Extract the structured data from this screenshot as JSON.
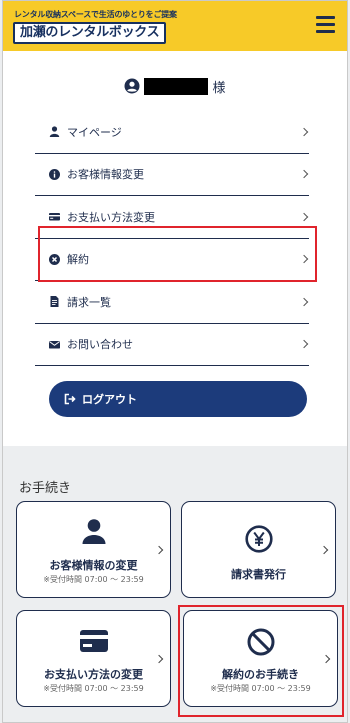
{
  "header": {
    "tagline": "レンタル収納スペースで生活のゆとりをご提案",
    "brand": "加瀬のレンタルボックス"
  },
  "user": {
    "suffix": "様"
  },
  "menu": {
    "items": [
      {
        "label": "マイページ",
        "icon": "user-icon"
      },
      {
        "label": "お客様情報変更",
        "icon": "info-icon"
      },
      {
        "label": "お支払い方法変更",
        "icon": "credit-card-icon"
      },
      {
        "label": "解約",
        "icon": "cancel-circle-icon"
      },
      {
        "label": "請求一覧",
        "icon": "document-icon"
      },
      {
        "label": "お問い合わせ",
        "icon": "envelope-icon"
      }
    ],
    "logout_label": "ログアウト"
  },
  "procedures": {
    "title": "お手続き",
    "cards": [
      {
        "title": "お客様情報の変更",
        "sub": "※受付時間 07:00 ～ 23:59",
        "icon": "person-icon"
      },
      {
        "title": "請求書発行",
        "sub": "",
        "icon": "yen-circle-icon"
      },
      {
        "title": "お支払い方法の変更",
        "sub": "※受付時間 07:00 ～ 23:59",
        "icon": "credit-card-icon"
      },
      {
        "title": "解約のお手続き",
        "sub": "※受付時間 07:00 ～ 23:59",
        "icon": "prohibited-icon"
      }
    ]
  },
  "colors": {
    "header_yellow": "#f7ca28",
    "navy": "#1c3b7b",
    "highlight_red": "#e0242c"
  }
}
